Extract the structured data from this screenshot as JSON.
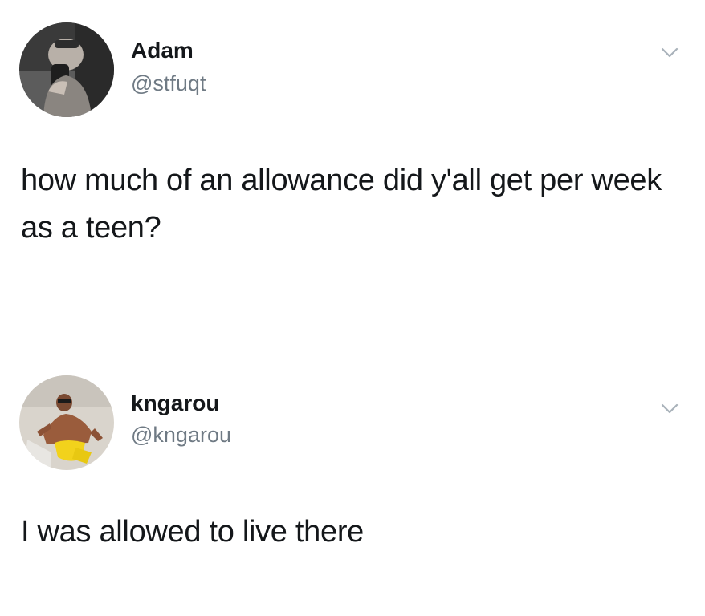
{
  "tweets": [
    {
      "display_name": "Adam",
      "handle": "@stfuqt",
      "text": "how much of an allowance did y'all get per week as a teen?",
      "avatar": "profile-photo-selfie",
      "menu_icon": "chevron-down-icon"
    },
    {
      "display_name": "kngarou",
      "handle": "@kngarou",
      "text": "I was allowed to live there",
      "avatar": "profile-photo-beach-lounger",
      "menu_icon": "chevron-down-icon"
    }
  ],
  "colors": {
    "text": "#14171a",
    "handle": "#6f7a84",
    "chevron": "#a9b2ba",
    "background": "#ffffff"
  }
}
